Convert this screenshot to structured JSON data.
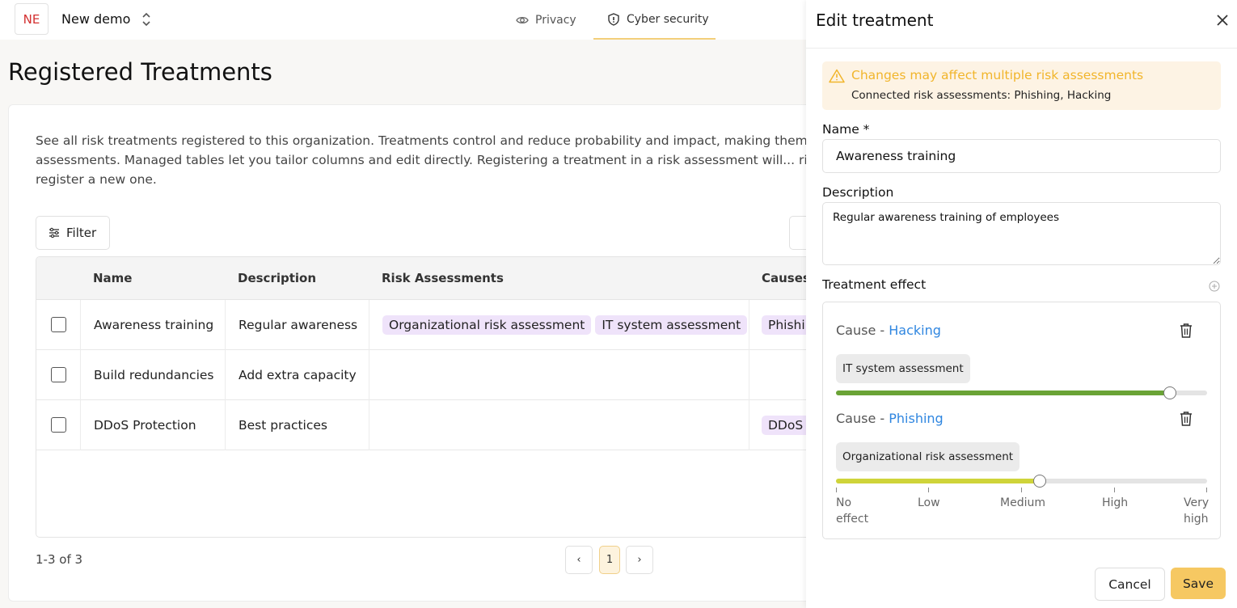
{
  "topbar": {
    "org_badge": "NE",
    "org_name": "New demo",
    "nav": [
      {
        "label": "Privacy",
        "icon": "eye-icon"
      },
      {
        "label": "Cyber security",
        "icon": "shield-icon",
        "active": true
      }
    ]
  },
  "page": {
    "title": "Registered Treatments",
    "description": "See all risk treatments registered to this organization. Treatments control and reduce probability and impact, making them vital for multiple assessments. Managed tables let you tailor columns and edit directly. Registering a treatment in a risk assessment will... right corner to register a new one.",
    "filter_label": "Filter"
  },
  "table": {
    "columns": [
      "Name",
      "Description",
      "Risk Assessments",
      "Causes"
    ],
    "rows": [
      {
        "name": "Awareness training",
        "description": "Regular awareness",
        "assessments": [
          "Organizational risk assessment",
          "IT system assessment"
        ],
        "causes": "Phishin"
      },
      {
        "name": "Build redundancies",
        "description": "Add extra capacity",
        "assessments": [],
        "causes": ""
      },
      {
        "name": "DDoS Protection",
        "description": "Best practices",
        "assessments": [],
        "causes": "DDoS A"
      }
    ],
    "pagination": {
      "count": "1-3 of 3",
      "current_page": "1",
      "prev": "‹",
      "next": "›"
    }
  },
  "drawer": {
    "title": "Edit treatment",
    "warning": {
      "title": "Changes may affect multiple risk assessments",
      "text": "Connected risk assessments: Phishing, Hacking"
    },
    "name_label": "Name *",
    "name_value": "Awareness training",
    "description_label": "Description",
    "description_value": "Regular awareness training of employees",
    "effect_label": "Treatment effect",
    "effects": [
      {
        "prefix": "Cause - ",
        "cause": "Hacking",
        "assessment": "IT system assessment",
        "level": 0.9,
        "color": "#6aa336"
      },
      {
        "prefix": "Cause - ",
        "cause": "Phishing",
        "assessment": "Organizational risk assessment",
        "level": 0.55,
        "color": "#cfd43a"
      }
    ],
    "scale": {
      "no_effect": [
        "No",
        "effect"
      ],
      "low": "Low",
      "medium": "Medium",
      "high": "High",
      "very_high": [
        "Very",
        "high"
      ]
    },
    "cancel_label": "Cancel",
    "save_label": "Save"
  }
}
